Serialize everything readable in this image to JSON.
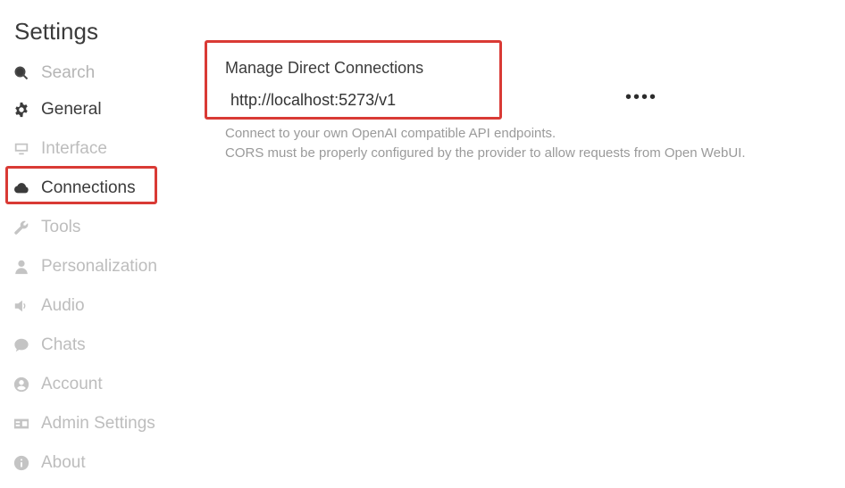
{
  "settings": {
    "title": "Settings"
  },
  "sidebar": {
    "search": {
      "label": "Search",
      "icon": "search-icon"
    },
    "items": [
      {
        "label": "General",
        "icon": "gear-icon",
        "state": "default"
      },
      {
        "label": "Interface",
        "icon": "monitor-icon",
        "state": "muted"
      },
      {
        "label": "Connections",
        "icon": "cloud-icon",
        "state": "selected"
      },
      {
        "label": "Tools",
        "icon": "wrench-icon",
        "state": "muted"
      },
      {
        "label": "Personalization",
        "icon": "user-icon",
        "state": "muted"
      },
      {
        "label": "Audio",
        "icon": "speaker-icon",
        "state": "muted"
      },
      {
        "label": "Chats",
        "icon": "chat-bubble-icon",
        "state": "muted"
      },
      {
        "label": "Account",
        "icon": "user-circle-icon",
        "state": "muted"
      },
      {
        "label": "Admin Settings",
        "icon": "id-card-icon",
        "state": "muted"
      },
      {
        "label": "About",
        "icon": "info-circle-icon",
        "state": "muted"
      }
    ]
  },
  "connections": {
    "title": "Manage Direct Connections",
    "url_value": "http://localhost:5273/v1",
    "key_mask": "••••",
    "description_line1": "Connect to your own OpenAI compatible API endpoints.",
    "description_line2": "CORS must be properly configured by the provider to allow requests from Open WebUI."
  },
  "colors": {
    "highlight_border": "#d93a35",
    "text_dark": "#3b3b3b",
    "text_muted": "#bdbdbd",
    "text_description": "#9a9a9a"
  }
}
